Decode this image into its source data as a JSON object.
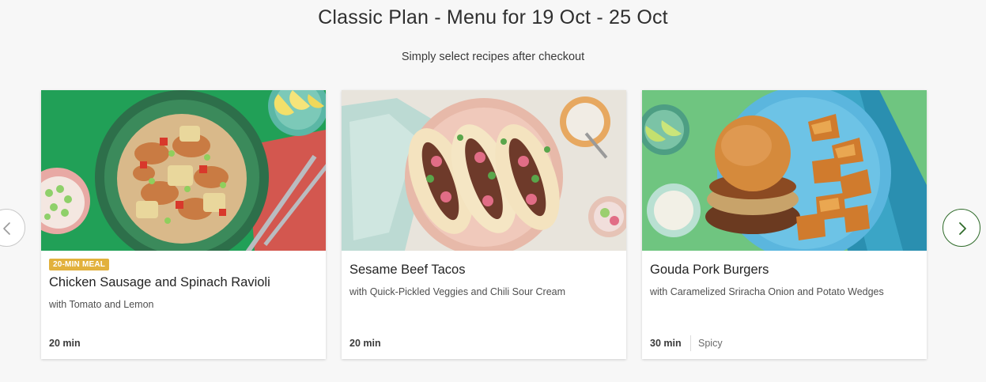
{
  "header": {
    "title": "Classic Plan - Menu for 19 Oct - 25 Oct",
    "subtitle": "Simply select recipes after checkout"
  },
  "carousel": {
    "prev_icon": "chevron-left-icon",
    "next_icon": "chevron-right-icon",
    "accent_color": "#2f6b2a",
    "recipes": [
      {
        "badge": "20-MIN MEAL",
        "badge_color": "#e2b13c",
        "name": "Chicken Sausage and Spinach Ravioli",
        "description": "with Tomato and Lemon",
        "time": "20 min"
      },
      {
        "name": "Sesame Beef Tacos",
        "description": "with Quick-Pickled Veggies and Chili Sour Cream",
        "time": "20 min"
      },
      {
        "name": "Gouda Pork Burgers",
        "description": "with Caramelized Sriracha Onion and Potato Wedges",
        "time": "30 min",
        "tag": "Spicy"
      }
    ]
  }
}
